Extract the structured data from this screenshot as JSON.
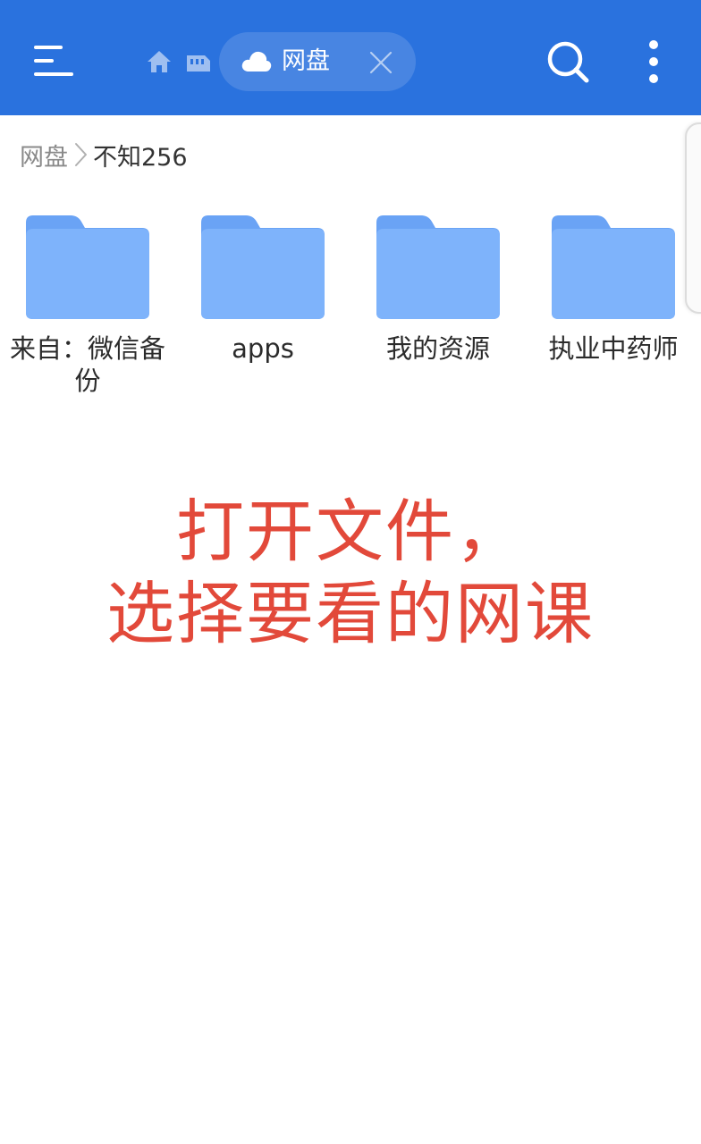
{
  "header": {
    "menu_icon": "hamburger-menu-icon",
    "home_icon": "home-icon",
    "storage_icon": "storage-card-icon",
    "active_tab": {
      "icon": "cloud-icon",
      "label": "网盘",
      "close_icon": "close-icon"
    },
    "search_icon": "search-icon",
    "more_icon": "more-vertical-icon",
    "background_color": "#2a72de"
  },
  "breadcrumb": {
    "root": "网盘",
    "separator_icon": "chevron-right-icon",
    "current": "不知256"
  },
  "folders": [
    {
      "name": "来自：微信备份",
      "icon": "folder-icon"
    },
    {
      "name": "apps",
      "icon": "folder-icon"
    },
    {
      "name": "我的资源",
      "icon": "folder-icon"
    },
    {
      "name": "执业中药师",
      "icon": "folder-icon"
    }
  ],
  "overlay": {
    "line1": "打开文件，",
    "line2": "选择要看的网课",
    "color": "#e2493a"
  }
}
